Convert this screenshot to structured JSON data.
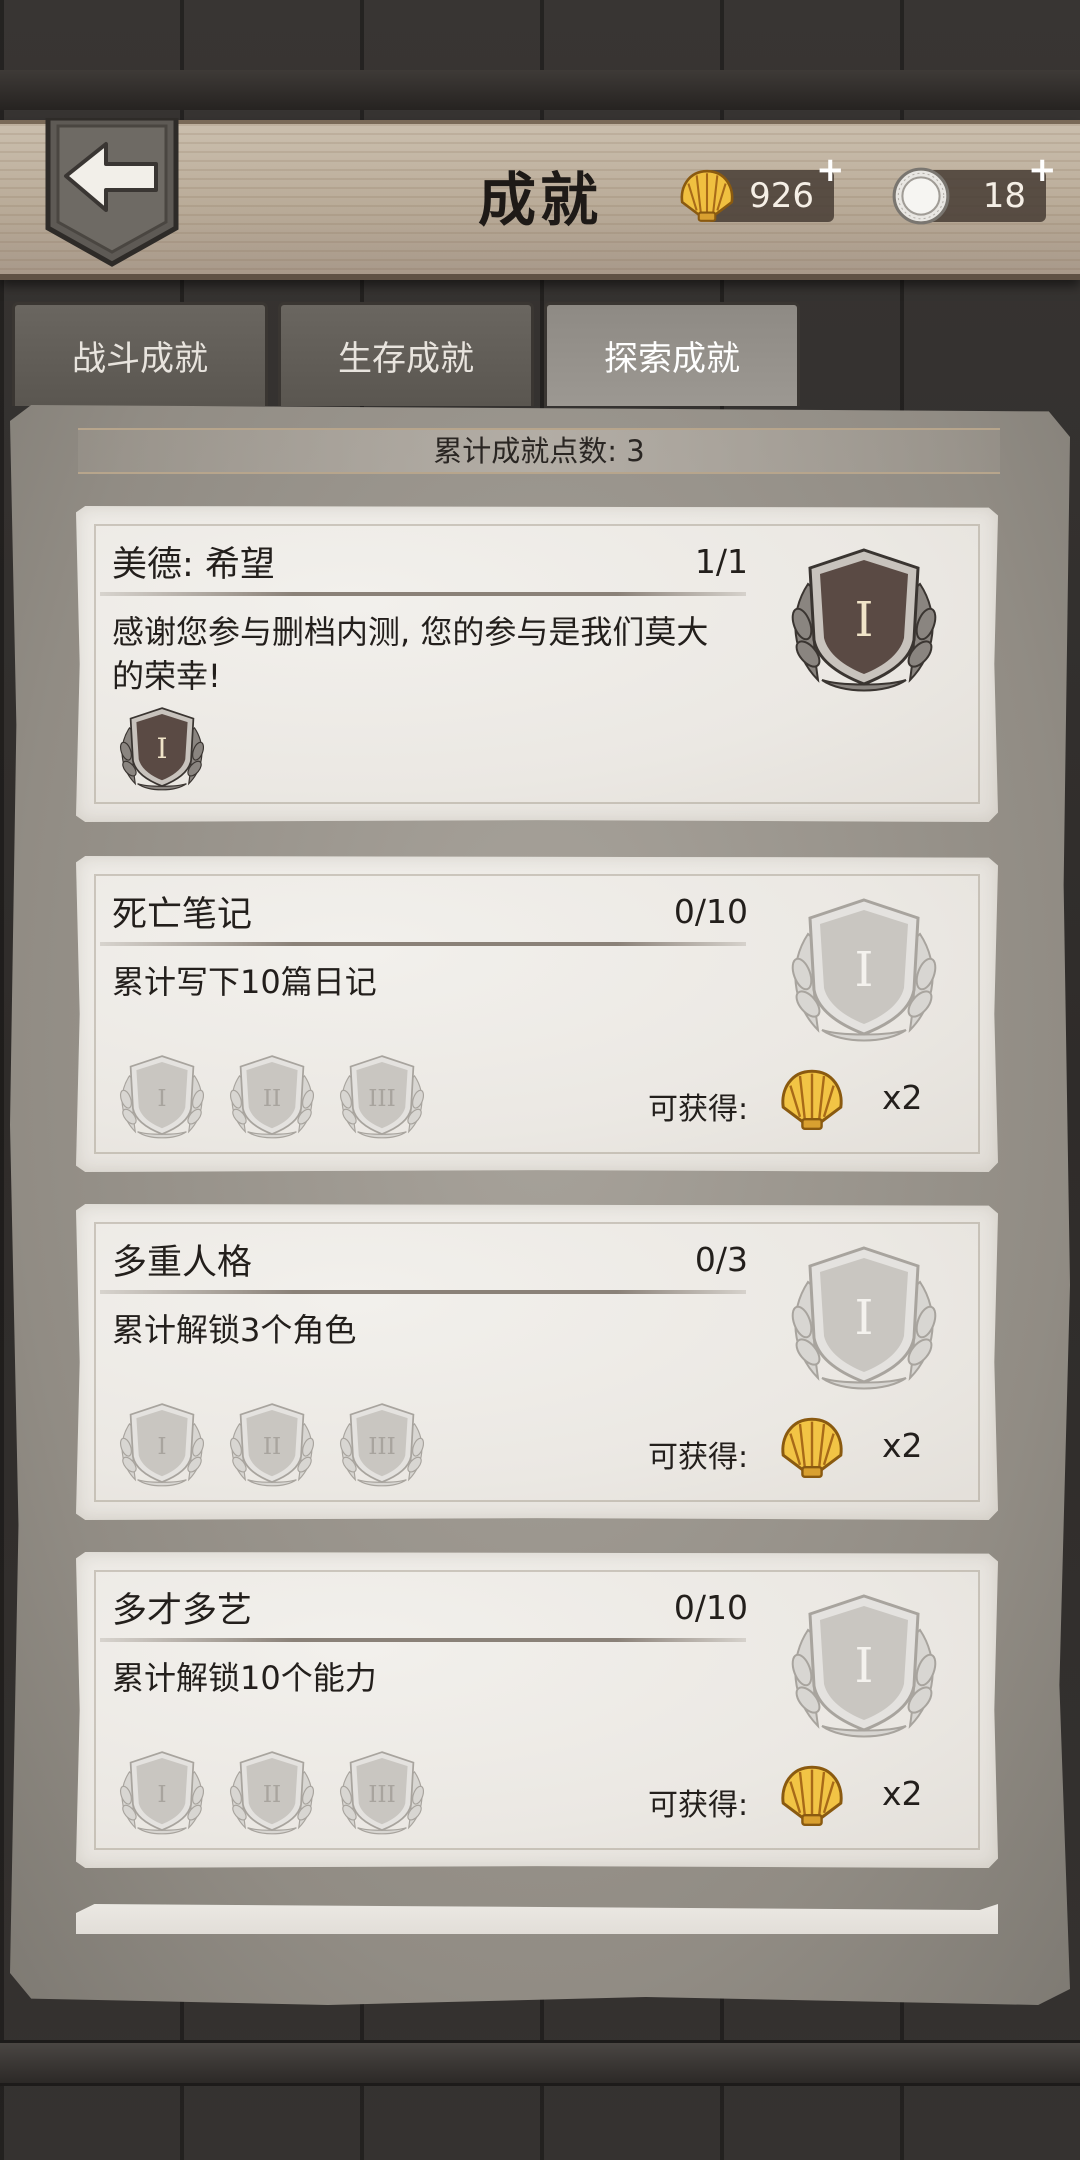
{
  "header": {
    "title": "成就",
    "shells": "926",
    "coins": "18",
    "plus": "+"
  },
  "tabs": [
    {
      "label": "战斗成就",
      "active": false
    },
    {
      "label": "生存成就",
      "active": false
    },
    {
      "label": "探索成就",
      "active": true
    }
  ],
  "points_text": "累计成就点数: 3",
  "cards": [
    {
      "title": "美德: 希望",
      "progress": "1/1",
      "desc": "感谢您参与删档内测, 您的参与是我们莫大的荣幸!",
      "state": "completed",
      "tiers": [
        "I"
      ]
    },
    {
      "title": "死亡笔记",
      "progress": "0/10",
      "desc": "累计写下10篇日记",
      "state": "locked",
      "tiers": [
        "I",
        "II",
        "III"
      ],
      "reward_label": "可获得:",
      "reward_count": "x2"
    },
    {
      "title": "多重人格",
      "progress": "0/3",
      "desc": "累计解锁3个角色",
      "state": "locked",
      "tiers": [
        "I",
        "II",
        "III"
      ],
      "reward_label": "可获得:",
      "reward_count": "x2"
    },
    {
      "title": "多才多艺",
      "progress": "0/10",
      "desc": "累计解锁10个能力",
      "state": "locked",
      "tiers": [
        "I",
        "II",
        "III"
      ],
      "reward_label": "可获得:",
      "reward_count": "x2"
    }
  ],
  "colors": {
    "panel": "#918c84",
    "card": "#ebe8e3",
    "medal_bronze": "#5a4a44",
    "medal_silver": "#c9c6c1",
    "shell_gold": "#e8b43a"
  },
  "icons": {
    "back": "arrow-left-icon",
    "shell": "shell-icon",
    "coin": "coin-icon",
    "medal": "medal-icon"
  }
}
